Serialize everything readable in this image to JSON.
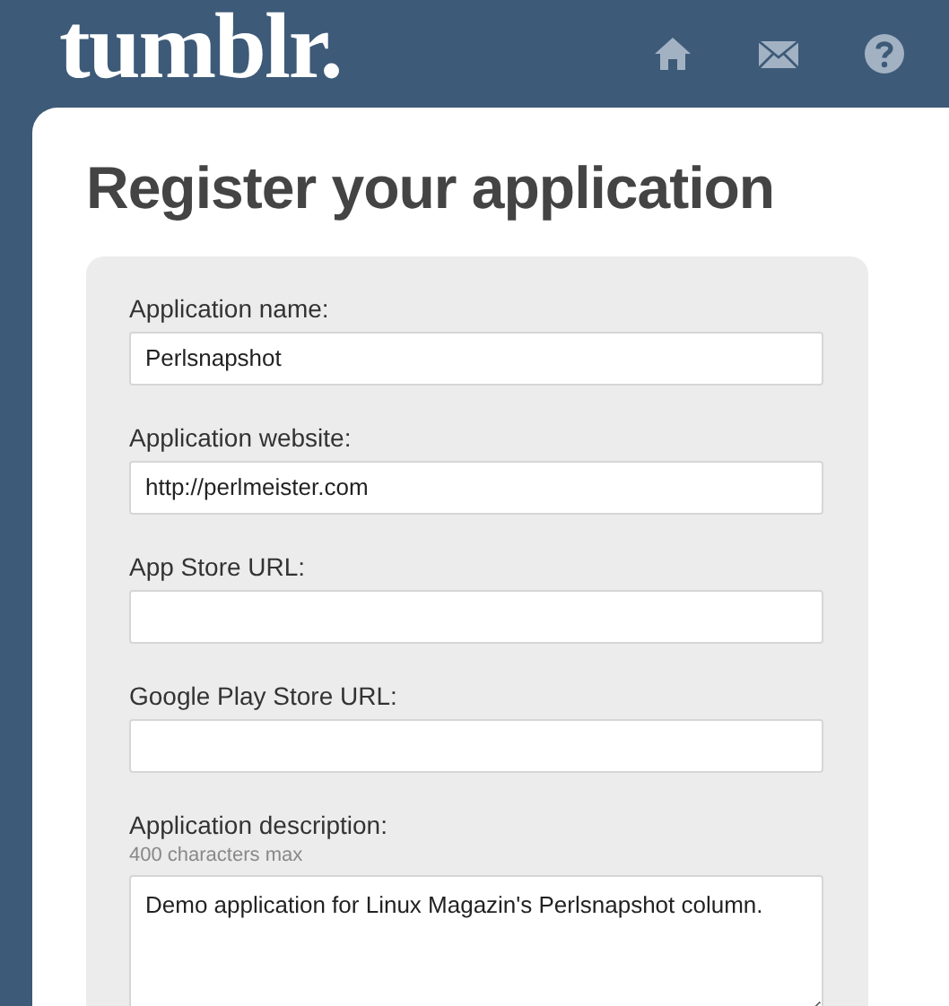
{
  "header": {
    "logo": "tumblr."
  },
  "title": "Register your application",
  "fields": [
    {
      "kind": "input",
      "label": "Application name:",
      "value": "Perlsnapshot"
    },
    {
      "kind": "input",
      "label": "Application website:",
      "value": "http://perlmeister.com"
    },
    {
      "kind": "input",
      "label": "App Store URL:"
    },
    {
      "kind": "input",
      "label": "Google Play Store URL:"
    },
    {
      "kind": "textarea",
      "label": "Application description:",
      "hint": "400 characters max",
      "value": "Demo application for Linux Magazin's Perlsnapshot column."
    }
  ]
}
